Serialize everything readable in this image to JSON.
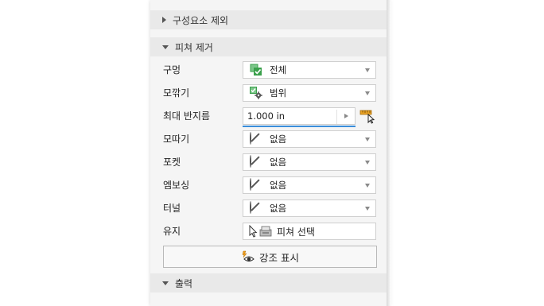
{
  "sections": {
    "exclude_components": {
      "title": "구성요소 제외",
      "expanded": false
    },
    "remove_features": {
      "title": "피쳐 제거",
      "expanded": true
    },
    "output": {
      "title": "출력",
      "expanded": true
    }
  },
  "rows": {
    "holes": {
      "label": "구멍",
      "value": "전체",
      "icon": "checked-feature-icon"
    },
    "fillets": {
      "label": "모깎기",
      "value": "범위",
      "icon": "range-gear-icon"
    },
    "max_radius": {
      "label": "최대 반지름",
      "value": "1.000 in"
    },
    "chamfers": {
      "label": "모따기",
      "value": "없음",
      "icon": "none-icon"
    },
    "pockets": {
      "label": "포켓",
      "value": "없음",
      "icon": "none-icon"
    },
    "embosses": {
      "label": "엠보싱",
      "value": "없음",
      "icon": "none-icon"
    },
    "tunnels": {
      "label": "터널",
      "value": "없음",
      "icon": "none-icon"
    },
    "preserve": {
      "label": "유지",
      "value": "피쳐 선택"
    }
  },
  "highlight_button": {
    "label": "강조 표시"
  },
  "colors": {
    "accent_green": "#3aa04b",
    "focus_blue": "#3a8edb",
    "ruler_orange": "#e8a224"
  }
}
